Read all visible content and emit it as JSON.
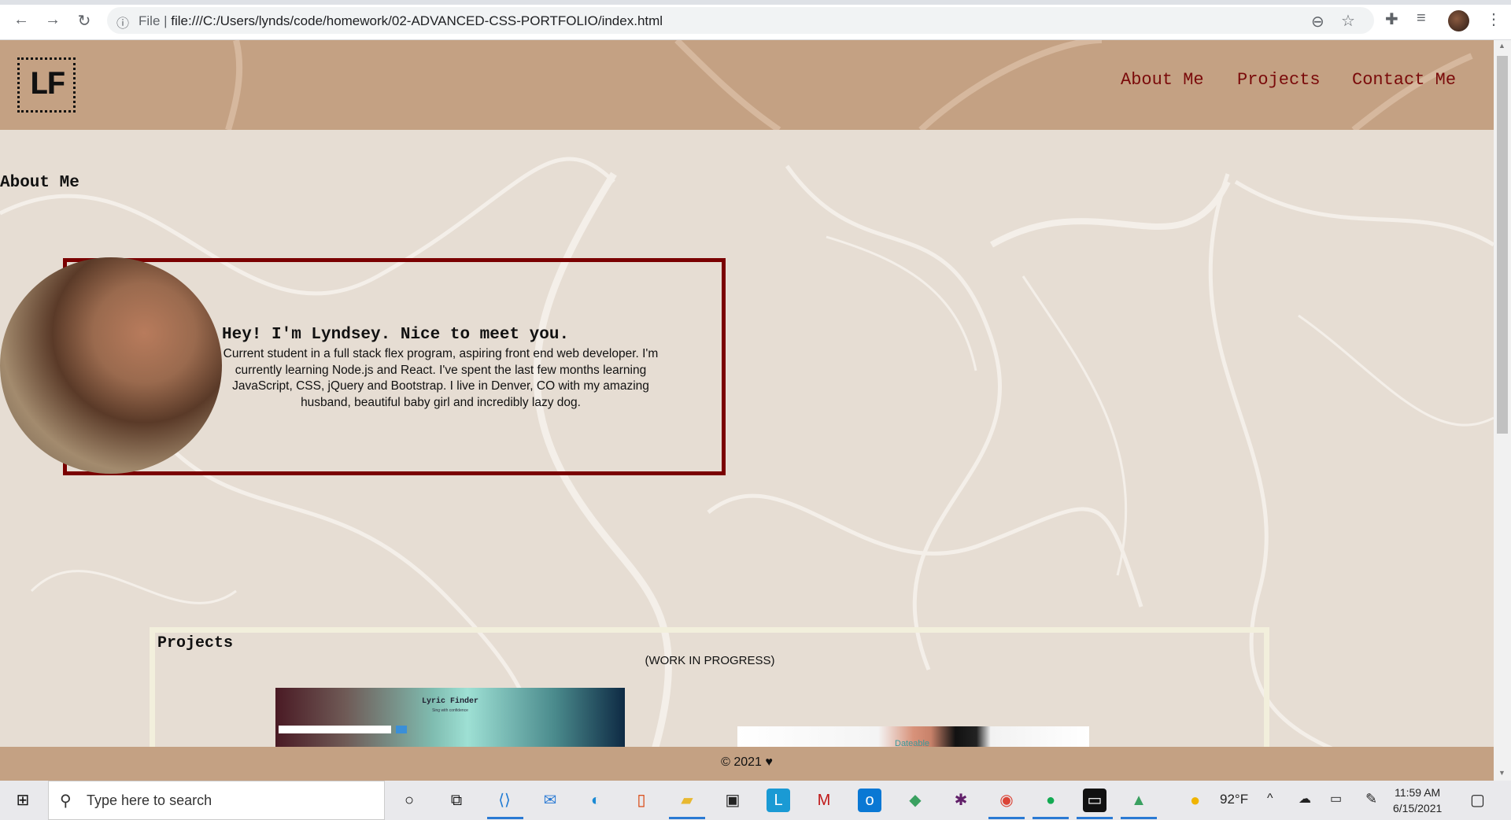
{
  "browser": {
    "url_label": "File",
    "url": "file:///C:/Users/lynds/code/homework/02-ADVANCED-CSS-PORTFOLIO/index.html"
  },
  "header": {
    "logo": "LF",
    "nav": [
      "About Me",
      "Projects",
      "Contact Me"
    ]
  },
  "about": {
    "heading": "About Me",
    "greeting": "Hey! I'm Lyndsey. Nice to meet you.",
    "bio": "Current student in a full stack flex program, aspiring front end web developer. I'm currently learning Node.js and React. I've spent the last few months learning JavaScript, CSS, jQuery and Bootstrap. I live in Denver, CO with my amazing husband, beautiful baby girl and incredibly lazy dog."
  },
  "projects": {
    "heading": "Projects",
    "note": "(WORK IN PROGRESS)",
    "items": [
      {
        "title": "Lyric Finder",
        "subtitle": "Sing with confidence"
      },
      {
        "title": "Dateable"
      }
    ]
  },
  "footer": {
    "text": "© 2021 ♥"
  },
  "taskbar": {
    "search_placeholder": "Type here to search",
    "weather": "92°F",
    "time": "11:59 AM",
    "date": "6/15/2021"
  },
  "colors": {
    "header_bg": "#c4a183",
    "page_bg": "#e6ddd3",
    "accent": "#7a0a0a",
    "card_border": "#7a0000"
  }
}
